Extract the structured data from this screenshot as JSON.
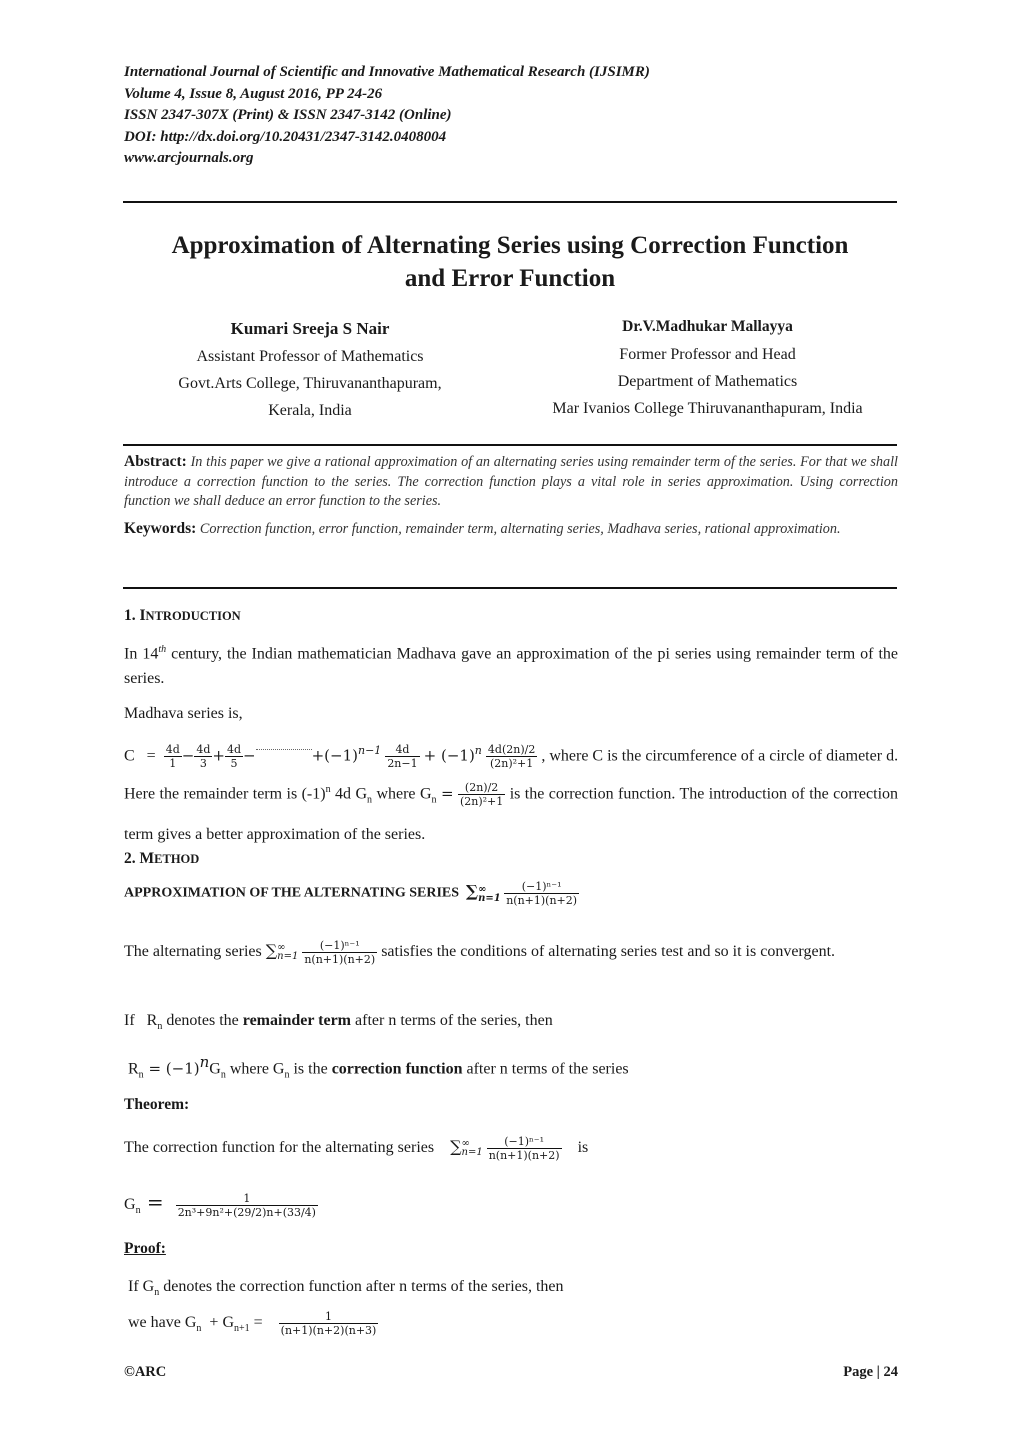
{
  "header": {
    "journal": "International Journal of Scientific and Innovative Mathematical Research (IJSIMR)",
    "volume": "Volume 4, Issue 8, August 2016, PP 24-26",
    "issn": "ISSN 2347-307X (Print) & ISSN 2347-3142 (Online)",
    "doi": "DOI: http://dx.doi.org/10.20431/2347-3142.0408004",
    "website": "www.arcjournals.org"
  },
  "title": {
    "line1": "Approximation of Alternating Series using Correction Function",
    "line2": "and Error Function"
  },
  "authors": [
    {
      "name": "Kumari Sreeja S Nair",
      "affiliation": [
        "Assistant Professor of Mathematics",
        "Govt.Arts College, Thiruvananthapuram,",
        "Kerala, India"
      ]
    },
    {
      "name": "Dr.V.Madhukar Mallayya",
      "affiliation": [
        "Former Professor and Head",
        "Department of Mathematics",
        "Mar Ivanios College Thiruvananthapuram, India"
      ]
    }
  ],
  "abstract": {
    "label": "Abstract:",
    "text": "In this paper we give a rational   approximation   of an alternating series using remainder term of the series. For that we shall introduce a correction function to the series. The correction function plays a vital role in series approximation. Using correction function we shall deduce an error function to the series."
  },
  "keywords": {
    "label": "Keywords:",
    "text": "Correction function, error function, remainder term, alternating series, Madhava series, rational approximation."
  },
  "intro": {
    "number": "1. ",
    "heading_first": "I",
    "heading_rest": "NTRODUCTION",
    "p1_a": "In 14",
    "p1_sup": "th",
    "p1_b": " century, the Indian mathematician Madhava gave an approximation of the pi series using remainder term of the series.",
    "p2": "Madhava series is,",
    "eq_lhs": "C   =",
    "eq_terms": {
      "t1_num": "4d",
      "t1_den": "1",
      "t2_num": "4d",
      "t2_den": "3",
      "t3_num": "4d",
      "t3_den": "5",
      "sign_pow1": "+(−1)",
      "pow1": "n−1",
      "t4_num": "4d",
      "t4_den": "2n−1",
      "sign_pow2": "+ (−1)",
      "pow2": "n",
      "t5_num": "4d(2n)/2",
      "t5_den": "(2n)²+1"
    },
    "eq_after": ", where C is the circumference of a circle of diameter d. Here the remainder term is (-1)",
    "rem_sup": "n",
    "rem_mid": " 4d G",
    "rem_sub": "n",
    "rem_where": " where G",
    "rem_where_sub": "n",
    "g_num": "(2n)/2",
    "g_den": "(2n)²+1",
    "after_g": " is the correction function. The introduction of the correction term gives a better approximation of the series."
  },
  "method": {
    "number": "2. ",
    "heading_first": "M",
    "heading_rest": "ETHOD",
    "subheading": "APPROXIMATION OF THE ALTERNATING SERIES",
    "series_upper": "∞",
    "series_lower": "n=1",
    "series_num": "(−1)ⁿ⁻¹",
    "series_den": "n(n+1)(n+2)",
    "p1_a": "The alternating series",
    "p1_b": " satisfies the conditions of alternating series test and so it is convergent.",
    "p2_a": "If   R",
    "p2_sub": "n",
    "p2_b": " denotes the ",
    "p2_bold": "remainder term",
    "p2_c": " after n terms of the series, then",
    "p3_a": "R",
    "p3_sub": "n",
    "p3_eq": " = (−1)",
    "p3_sup": "n",
    "p3_b": "G",
    "p3_sub2": "n",
    "p3_c": " where G",
    "p3_sub3": "n",
    "p3_d": " is the ",
    "p3_bold": "correction function",
    "p3_e": " after n terms of the series",
    "theorem_label": "Theorem:",
    "theorem_a": "The correction function for the alternating series",
    "theorem_b": "is",
    "gn_lhs": "G",
    "gn_sub": "n",
    "gn_eq": " =",
    "gn_num": "1",
    "gn_den": "2n³+9n²+(29/2)n+(33/4)",
    "proof_label": "Proof:",
    "proof_p1_a": "If G",
    "proof_p1_sub": "n",
    "proof_p1_b": " denotes the correction function after n terms of the series, then",
    "proof_p2_a": "we have G",
    "proof_p2_sub": "n",
    "proof_p2_b": "  + G",
    "proof_p2_sub2": "n+1",
    "proof_p2_eq": " =",
    "proof_num": "1",
    "proof_den": "(n+1)(n+2)(n+3)"
  },
  "footer": {
    "left": "©ARC",
    "right": "Page | 24"
  }
}
